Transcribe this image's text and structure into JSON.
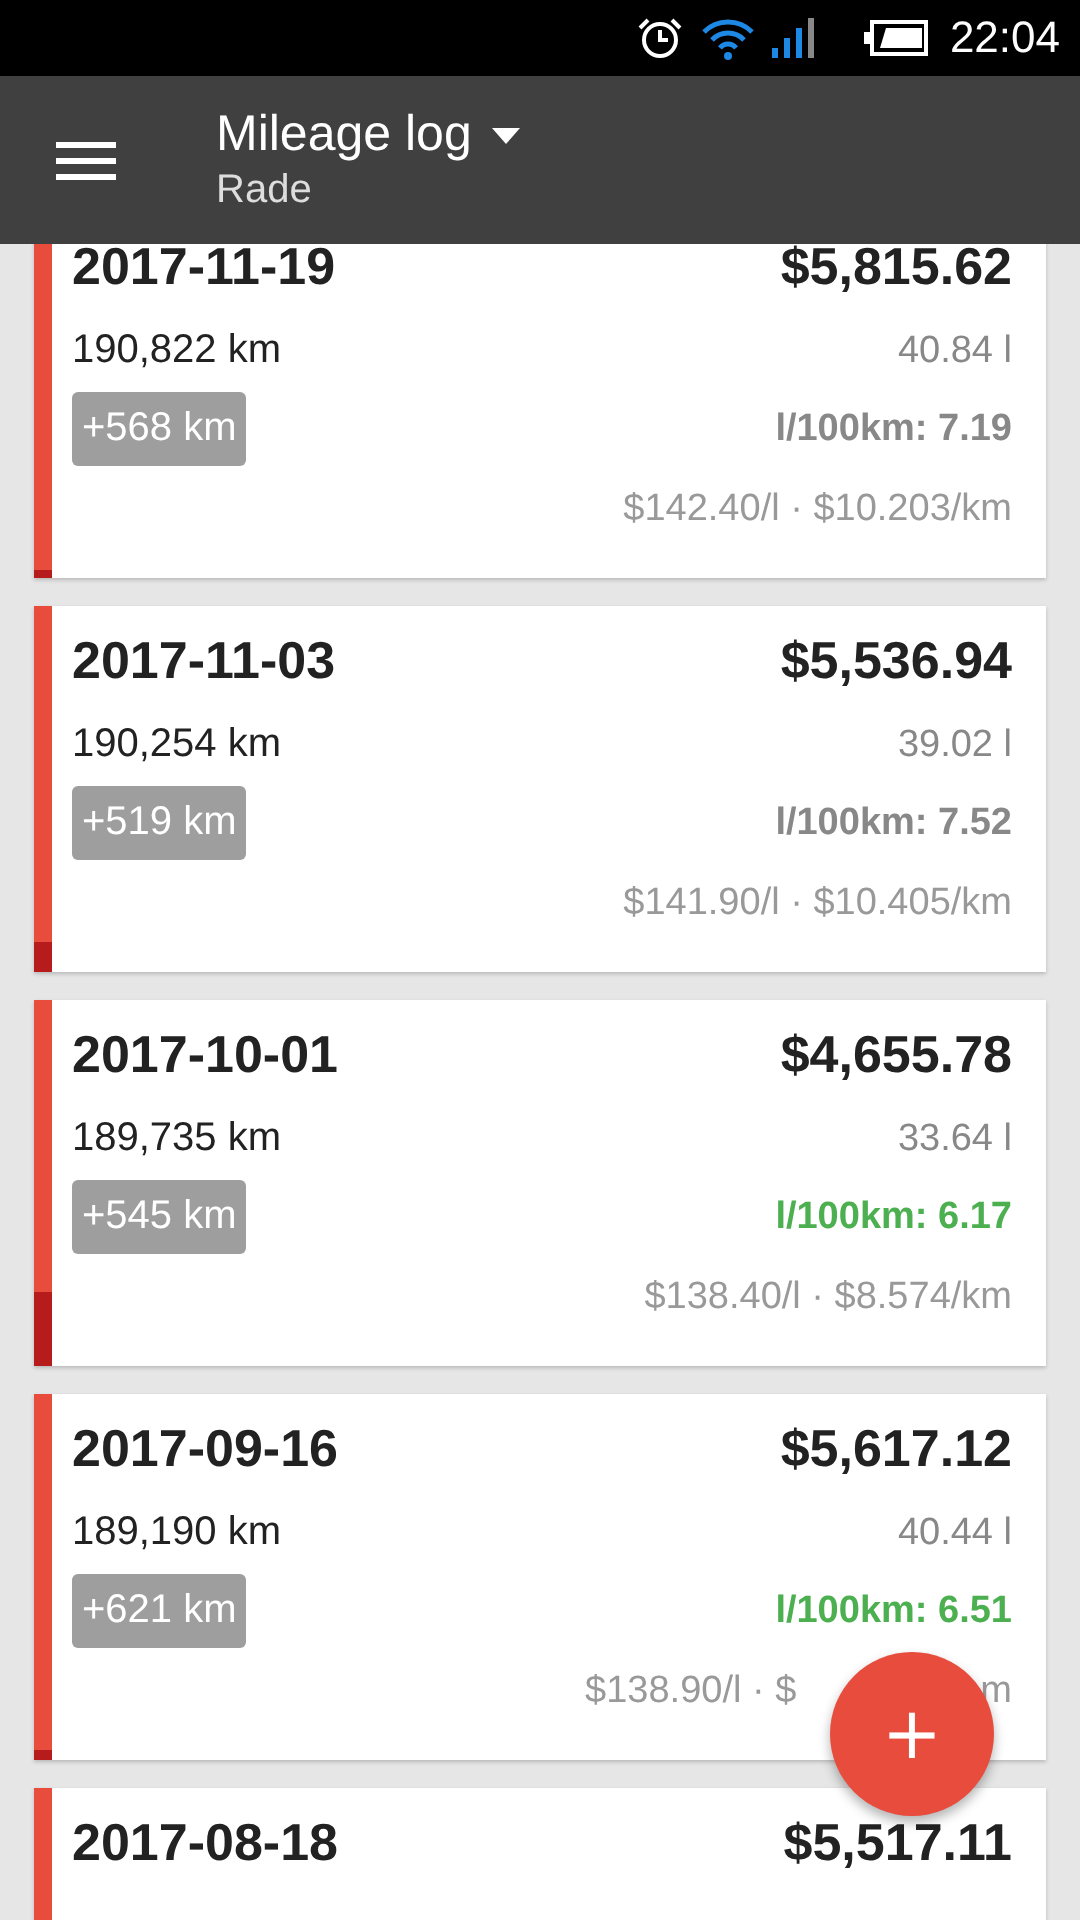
{
  "status_bar": {
    "time": "22:04"
  },
  "app_bar": {
    "title": "Mileage log",
    "subtitle": "Rade"
  },
  "entries": [
    {
      "date": "2017-11-19",
      "total": "$5,815.62",
      "odometer": "190,822 km",
      "liters": "40.84 l",
      "distance": "+568 km",
      "efficiency": "l/100km: 7.19",
      "good": false,
      "cost": "$142.40/l · $10.203/km",
      "level": 0.02
    },
    {
      "date": "2017-11-03",
      "total": "$5,536.94",
      "odometer": "190,254 km",
      "liters": "39.02 l",
      "distance": "+519 km",
      "efficiency": "l/100km: 7.52",
      "good": false,
      "cost": "$141.90/l · $10.405/km",
      "level": 0.08
    },
    {
      "date": "2017-10-01",
      "total": "$4,655.78",
      "odometer": "189,735 km",
      "liters": "33.64 l",
      "distance": "+545 km",
      "efficiency": "l/100km: 6.17",
      "good": true,
      "cost": "$138.40/l · $8.574/km",
      "level": 0.2
    },
    {
      "date": "2017-09-16",
      "total": "$5,617.12",
      "odometer": "189,190 km",
      "liters": "40.44 l",
      "distance": "+621 km",
      "efficiency": "l/100km: 6.51",
      "good": true,
      "cost": "$138.90/l · $",
      "cost_end": "m",
      "level": 0.03
    },
    {
      "date": "2017-08-18",
      "total": "$5,517.11"
    }
  ],
  "fab": {
    "label": "+"
  }
}
